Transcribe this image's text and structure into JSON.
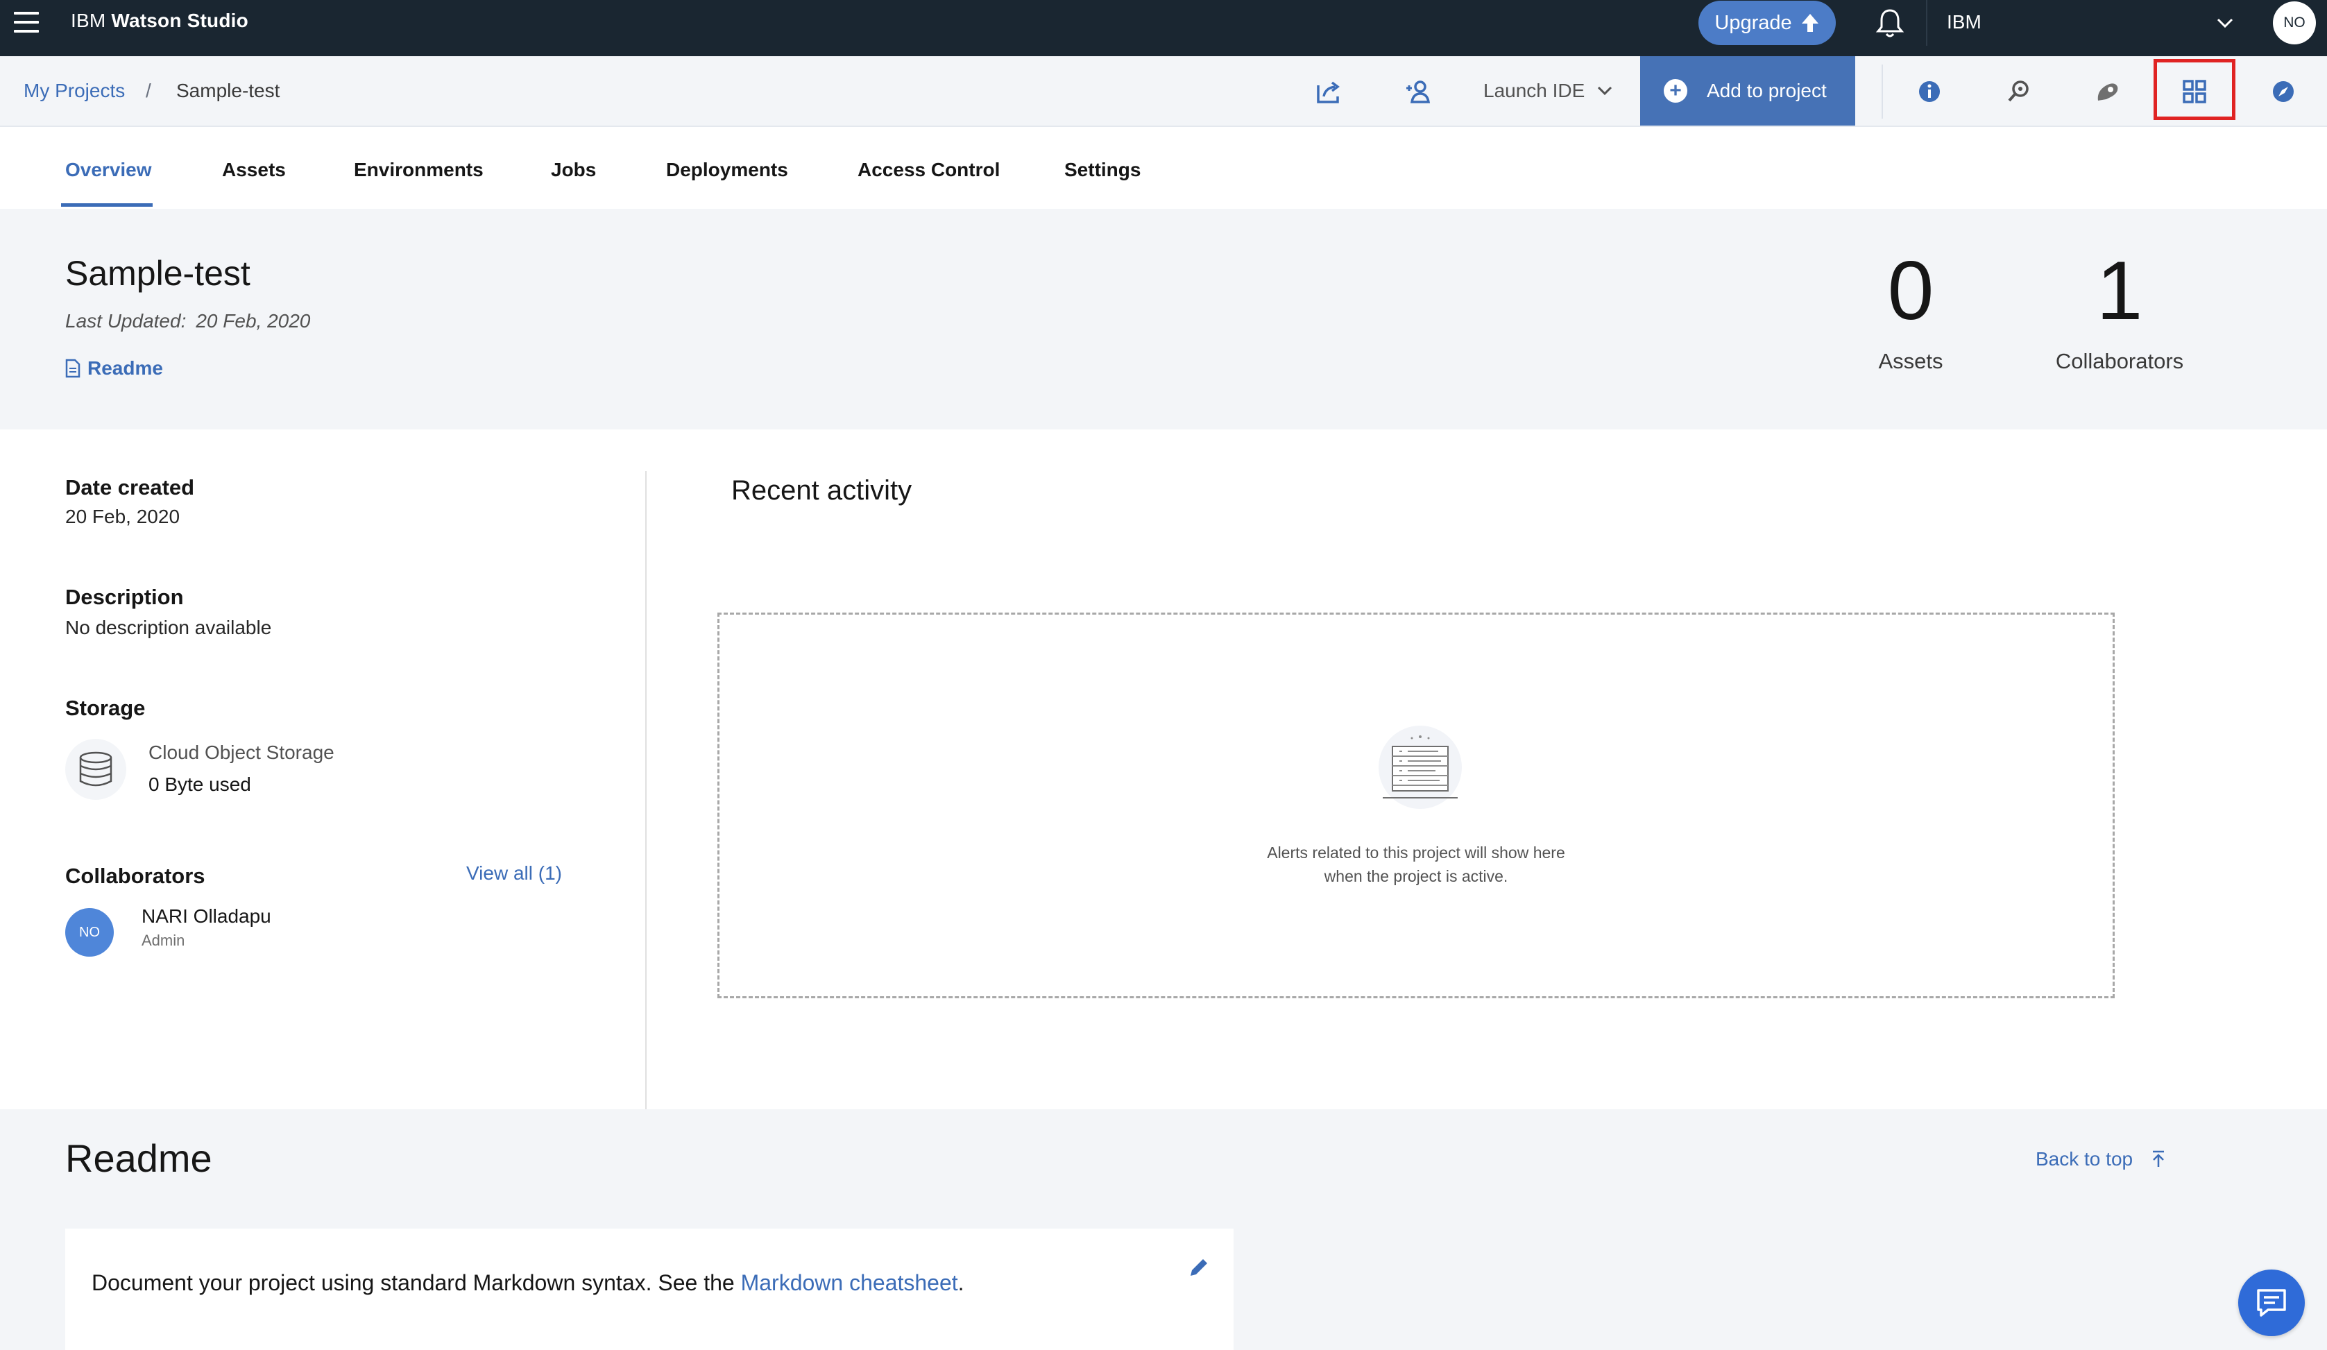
{
  "topbar": {
    "brand_prefix": "IBM",
    "brand_name": "Watson Studio",
    "upgrade_label": "Upgrade",
    "account_name": "IBM",
    "avatar_initials": "NO"
  },
  "breadcrumb": {
    "root": "My Projects",
    "separator": "/",
    "current": "Sample-test"
  },
  "toolbar": {
    "launch_ide_label": "Launch IDE",
    "add_to_project_label": "Add to project",
    "icons": [
      "export-icon",
      "add-collaborator-icon",
      "info-icon",
      "find-icon",
      "community-icon",
      "grid-view-icon",
      "compass-icon"
    ],
    "accent": "#4672b6",
    "highlight_color": "#e02323"
  },
  "tabs": {
    "items": [
      "Overview",
      "Assets",
      "Environments",
      "Jobs",
      "Deployments",
      "Access Control",
      "Settings"
    ],
    "active": "Overview"
  },
  "header": {
    "title": "Sample-test",
    "last_updated_label": "Last Updated:",
    "last_updated_value": "20 Feb, 2020",
    "readme_link": "Readme",
    "stats": [
      {
        "value": "0",
        "label": "Assets"
      },
      {
        "value": "1",
        "label": "Collaborators"
      }
    ]
  },
  "details": {
    "date_created_label": "Date created",
    "date_created_value": "20 Feb, 2020",
    "description_label": "Description",
    "description_value": "No description available",
    "storage_label": "Storage",
    "storage_name": "Cloud Object Storage",
    "storage_used": "0 Byte used",
    "collaborators_label": "Collaborators",
    "view_all_label": "View all (1)",
    "collaborator": {
      "initials": "NO",
      "name": "NARI Olladapu",
      "role": "Admin"
    }
  },
  "recent_activity": {
    "title": "Recent activity",
    "empty_line1": "Alerts related to this project will show here",
    "empty_line2": "when the project is active."
  },
  "readme": {
    "title": "Readme",
    "back_to_top": "Back to top",
    "text_before": "Document your project using standard Markdown syntax. See the ",
    "link_text": "Markdown cheatsheet",
    "text_after": "."
  }
}
